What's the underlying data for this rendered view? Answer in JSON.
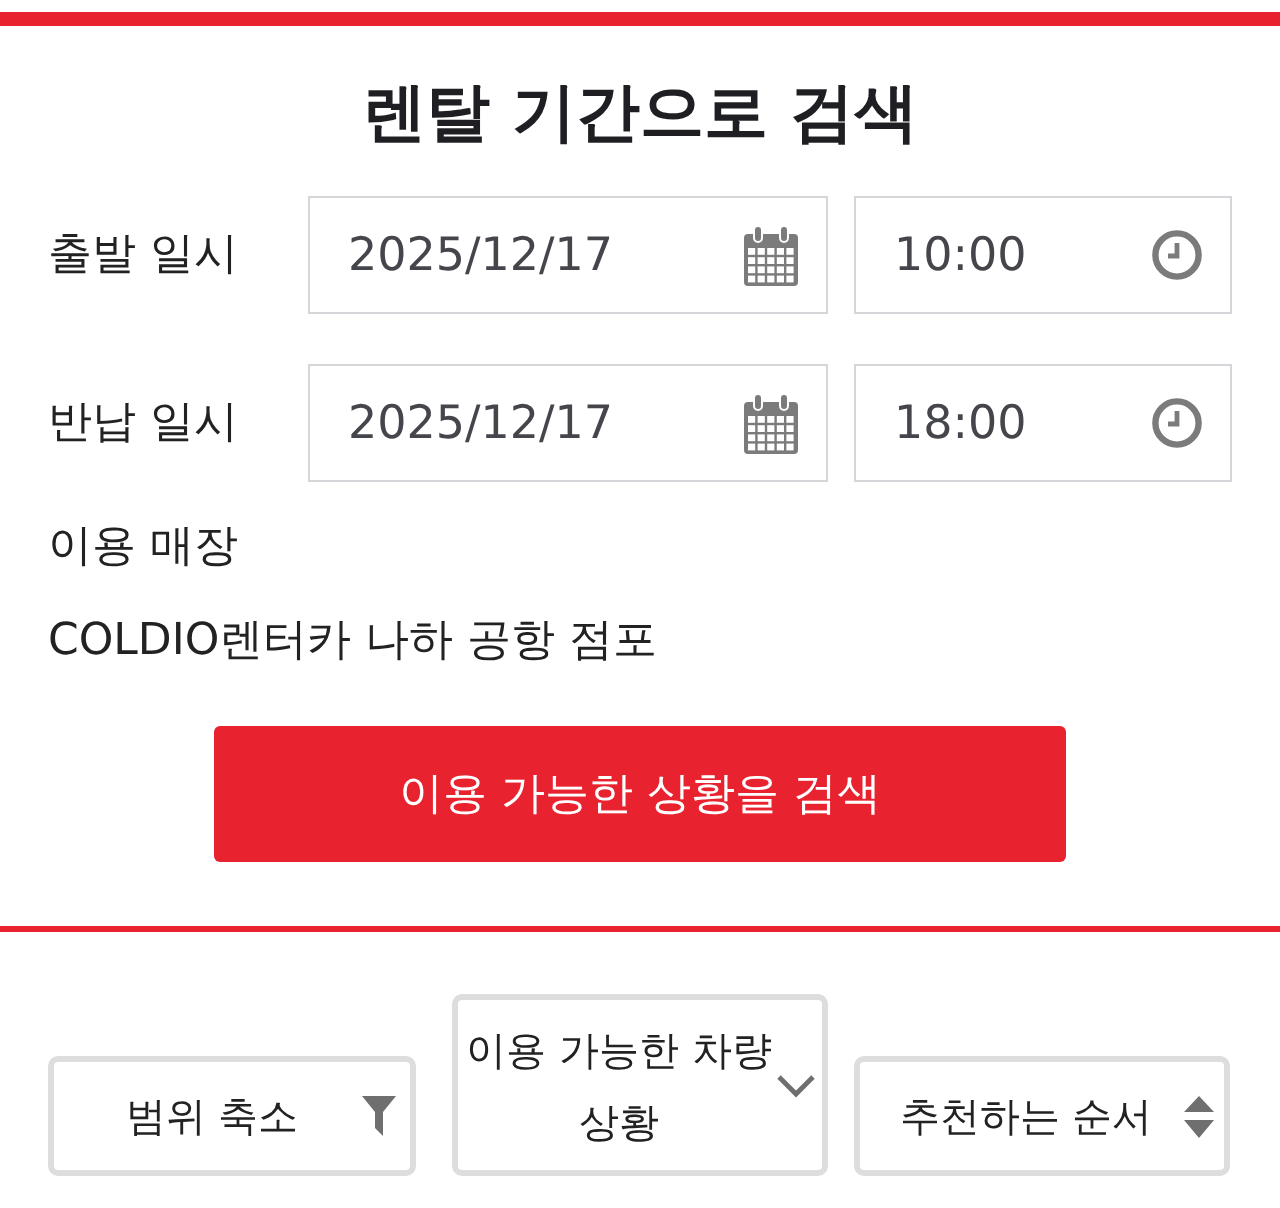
{
  "title": "렌탈 기간으로 검색",
  "schedule": [
    {
      "label": "출발 일시",
      "date": "2025/12/17",
      "time": "10:00"
    },
    {
      "label": "반납 일시",
      "date": "2025/12/17",
      "time": "18:00"
    }
  ],
  "store": {
    "label": "이용 매장",
    "value": "COLDIO렌터카 나하 공항 점포"
  },
  "search_button": "이용 가능한 상황을 검색",
  "controls": [
    {
      "kind": "filter",
      "label": "범위 축소"
    },
    {
      "kind": "dropdown",
      "label": "이용 가능한 차량 상황"
    },
    {
      "kind": "sort",
      "label": "추천하는 순서"
    }
  ]
}
